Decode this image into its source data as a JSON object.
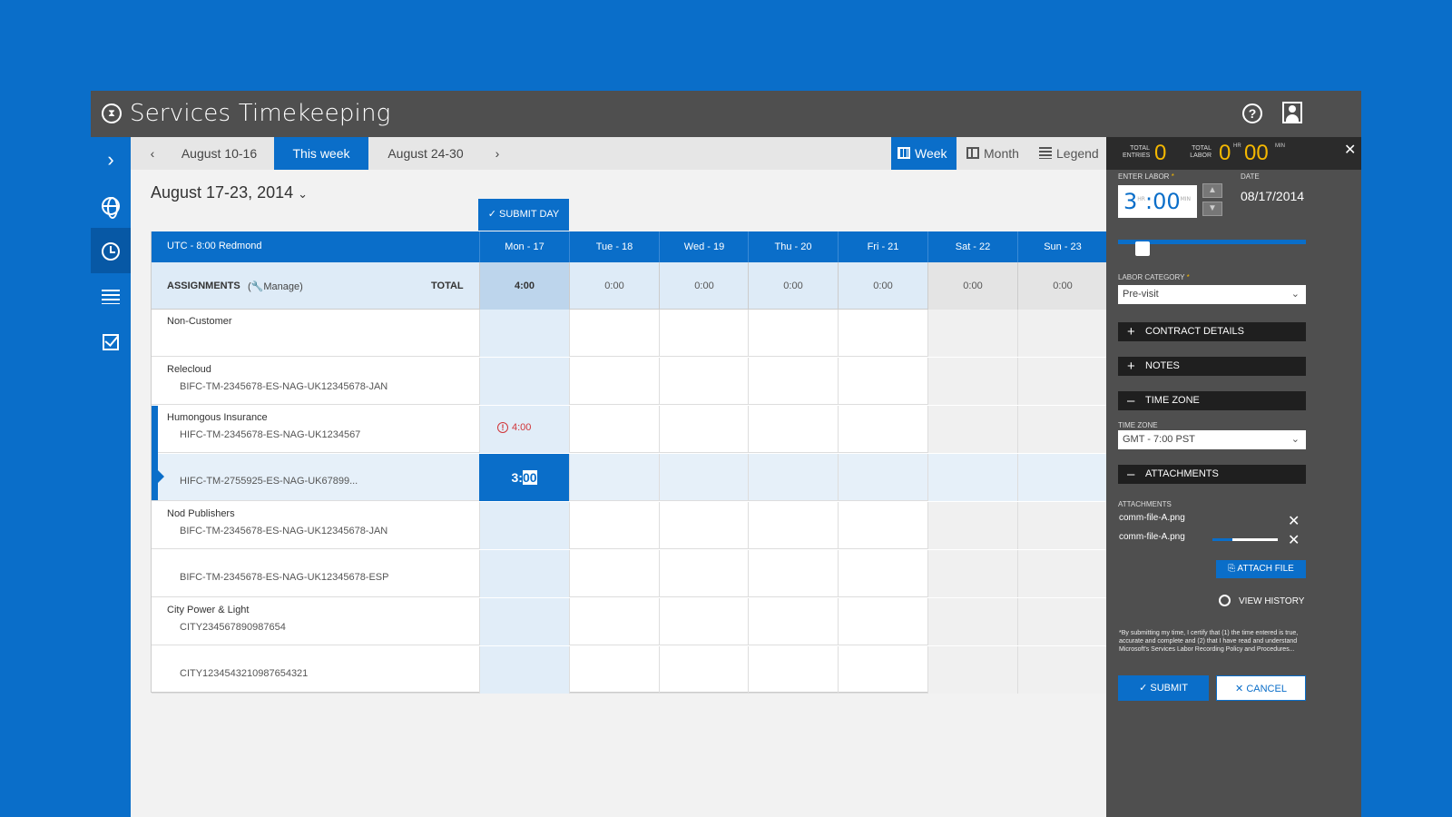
{
  "app": {
    "title": "Services Timekeeping",
    "logo_icon": "timer-icon"
  },
  "header": {
    "help_icon": "?",
    "user_icon": "user-icon"
  },
  "leftnav": [
    "expand",
    "globe",
    "clock",
    "list",
    "checklist"
  ],
  "subnav": {
    "prev_icon": "‹",
    "prev_week": "August 10-16",
    "this_week": "This week",
    "next_week": "August 24-30",
    "next_icon": "›",
    "views": [
      "Week",
      "Month",
      "Legend"
    ],
    "selected_view": "Week"
  },
  "date_range": "August 17-23, 2014",
  "submit_day": "SUBMIT DAY",
  "grid": {
    "timezone": "UTC - 8:00 Redmond",
    "days": [
      "Mon - 17",
      "Tue - 18",
      "Wed - 19",
      "Thu - 20",
      "Fri - 21",
      "Sat - 22",
      "Sun - 23"
    ],
    "assignments_label": "ASSIGNMENTS",
    "manage_label": "Manage",
    "total_label": "TOTAL",
    "totals": [
      "4:00",
      "0:00",
      "0:00",
      "0:00",
      "0:00",
      "0:00",
      "0:00"
    ],
    "rows": [
      {
        "name": "Non-Customer",
        "code": ""
      },
      {
        "name": "Relecloud",
        "code": "BIFC-TM-2345678-ES-NAG-UK12345678-JAN"
      },
      {
        "name": "Humongous Insurance",
        "code": "HIFC-TM-2345678-ES-NAG-UK1234567",
        "mon": "4:00"
      },
      {
        "name": "",
        "code": "HIFC-TM-2755925-ES-NAG-UK67899...",
        "edit_hr": "3:",
        "edit_min": "00"
      },
      {
        "name": "Nod Publishers",
        "code": "BIFC-TM-2345678-ES-NAG-UK12345678-JAN"
      },
      {
        "name": "",
        "code": "BIFC-TM-2345678-ES-NAG-UK12345678-ESP"
      },
      {
        "name": "City Power & Light",
        "code": "CITY234567890987654"
      },
      {
        "name": "",
        "code": "CITY1234543210987654321"
      }
    ]
  },
  "panel": {
    "total_entries_label": "TOTAL ENTRIES",
    "total_entries": "0",
    "total_labor_label": "TOTAL LABOR",
    "total_labor_hr": "0",
    "total_labor_min": "00",
    "hr_unit": "HR",
    "min_unit": "MIN",
    "enter_labor_label": "ENTER LABOR",
    "labor_hr": "3",
    "labor_min": "00",
    "date_label": "DATE",
    "date_value": "08/17/2014",
    "labor_level": 0.1,
    "labor_category_label": "LABOR CATEGORY",
    "labor_category": "Pre-visit",
    "contract_details": "CONTRACT DETAILS",
    "notes": "NOTES",
    "time_zone_section": "TIME ZONE",
    "time_zone_label": "TIME ZONE",
    "time_zone_value": "GMT - 7:00 PST",
    "attachments_section": "ATTACHMENTS",
    "attachments_label": "ATTACHMENTS",
    "attachments": [
      "comm-file-A.png",
      "comm-file-A.png"
    ],
    "upload_progress": 0.7,
    "attach_file": "ATTACH FILE",
    "view_history": "VIEW HISTORY",
    "disclaimer": "*By submitting my time, I certify that (1) the time entered is true, accurate and complete and (2) that I have read and understand Microsoft's Services Labor Recording Policy and Procedures...",
    "submit": "SUBMIT",
    "cancel": "CANCEL"
  },
  "colors": {
    "accent": "#0a6ec9",
    "titlebar": "#4f4f4f",
    "highlight": "#f5b800",
    "error": "#d13438"
  }
}
